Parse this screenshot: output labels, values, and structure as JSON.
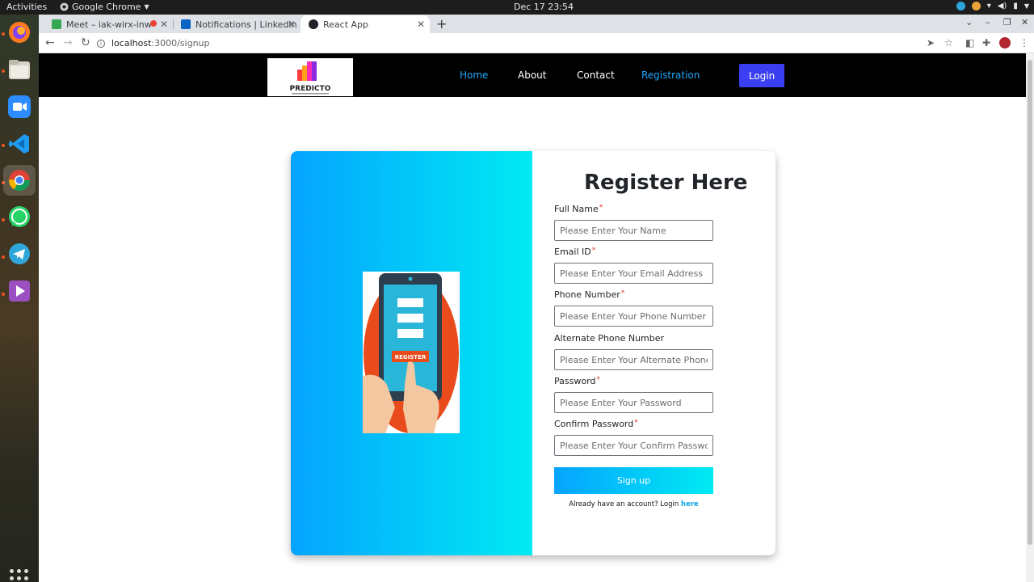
{
  "system": {
    "activities": "Activities",
    "app_menu": "Google Chrome",
    "clock": "Dec 17  23:54"
  },
  "browser": {
    "tabs": [
      {
        "title": "Meet – iak-wirx-inw",
        "favicon_color": "#34a853"
      },
      {
        "title": "Notifications | LinkedIn",
        "favicon_color": "#0a66c2"
      },
      {
        "title": "React App",
        "favicon_color": "#20232a"
      }
    ],
    "new_tab": "+",
    "url_host": "localhost",
    "url_path": ":3000/signup"
  },
  "navbar": {
    "logo_text": "PREDICTO",
    "links": [
      "Home",
      "About",
      "Contact",
      "Registration"
    ],
    "login_label": "Login"
  },
  "form": {
    "title": "Register Here",
    "fields": [
      {
        "label": "Full Name",
        "required": true,
        "placeholder": "Please Enter Your Name"
      },
      {
        "label": "Email ID",
        "required": true,
        "placeholder": "Please Enter Your Email Address"
      },
      {
        "label": "Phone Number",
        "required": true,
        "placeholder": "Please Enter Your Phone Number"
      },
      {
        "label": "Alternate Phone Number",
        "required": false,
        "placeholder": "Please Enter Your Alternate Phone No."
      },
      {
        "label": "Password",
        "required": true,
        "placeholder": "Please Enter Your Password"
      },
      {
        "label": "Confirm Password",
        "required": true,
        "placeholder": "Please Enter Your Confirm Password"
      }
    ],
    "required_mark": "*",
    "submit_label": "Sign up",
    "login_prompt": "Already have an account? Login",
    "login_link": "here",
    "illustration_button": "REGISTER"
  },
  "colors": {
    "gradient_start": "#05a4ff",
    "gradient_end": "#00eaf2",
    "login_button": "#3a3ff2",
    "nav_active": "#1ea7ff"
  }
}
